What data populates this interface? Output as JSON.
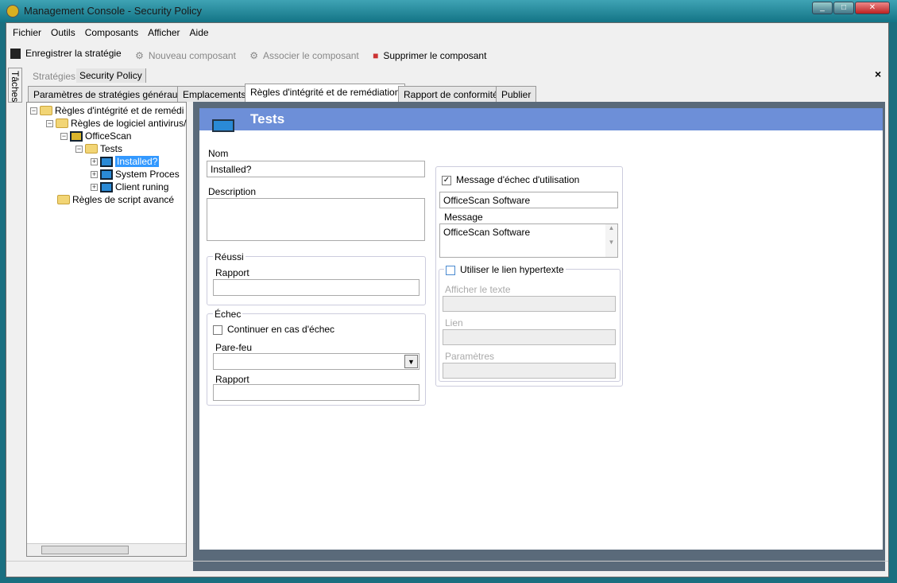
{
  "window": {
    "title": "Management Console  - Security Policy"
  },
  "menu": [
    "Fichier",
    "Outils",
    "Composants",
    "Afficher",
    "Aide"
  ],
  "toolbar": {
    "save": "Enregistrer la stratégie",
    "new": "Nouveau composant",
    "assoc": "Associer le composant",
    "delete": "Supprimer le composant"
  },
  "side_tab": "Tâches",
  "doc_tabs": [
    "Stratégies",
    "Security Policy"
  ],
  "tabs": [
    "Paramètres de stratégies généraux",
    "Emplacements",
    "Règles d'intégrité et de remédiation",
    "Rapport de conformité",
    "Publier"
  ],
  "tree": [
    "Règles d'intégrité et de remédi",
    "Règles de logiciel antivirus/",
    "OfficeScan",
    "Tests",
    "Installed?",
    "System Proces",
    "Client runing",
    "Règles de script avancé"
  ],
  "form": {
    "header": "Tests",
    "nom_label": "Nom",
    "nom_value": "Installed?",
    "desc_label": "Description",
    "reussi": "Réussi",
    "rapport": "Rapport",
    "echec": "Échec",
    "continuer": "Continuer en cas d'échec",
    "parefeu": "Pare-feu",
    "msg_check": "Message d'échec d'utilisation",
    "msg_title": "OfficeScan Software",
    "message_label": "Message",
    "message_value": "OfficeScan Software",
    "link_check": "Utiliser le lien hypertexte",
    "afficher": "Afficher le texte",
    "lien": "Lien",
    "params": "Paramètres"
  }
}
